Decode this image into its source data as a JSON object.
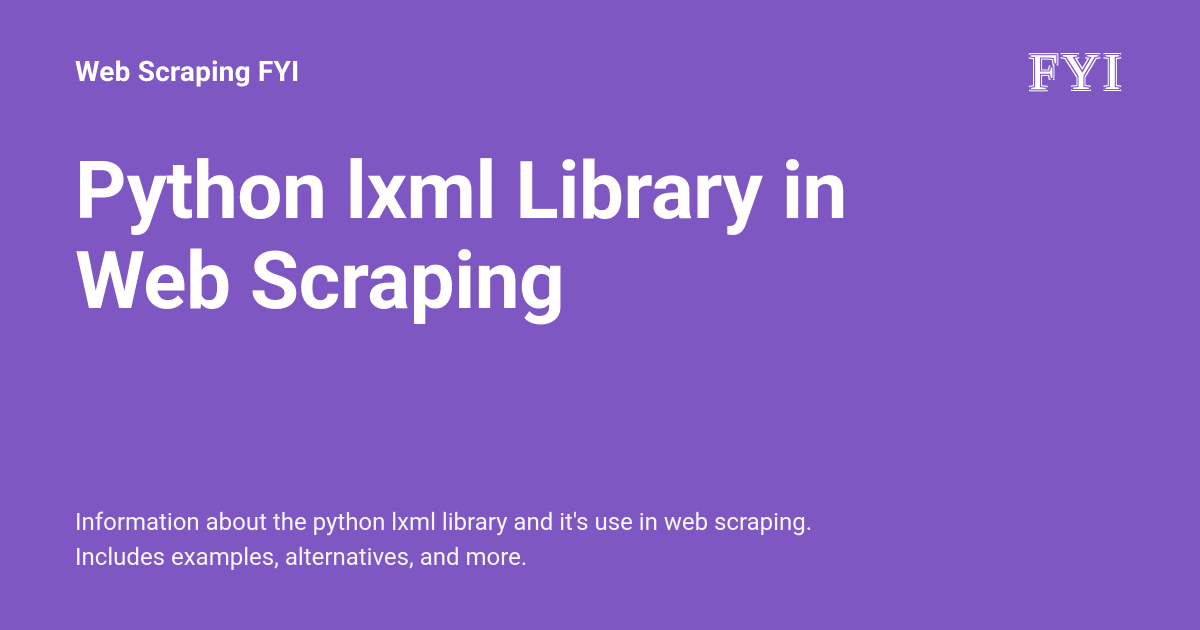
{
  "header": {
    "site_name": "Web Scraping FYI",
    "logo_text": "FYI"
  },
  "main": {
    "title": "Python lxml Library in Web Scraping",
    "description": "Information about the python lxml library and it's use in web scraping. Includes examples, alternatives, and more."
  },
  "colors": {
    "background": "#7E57C2",
    "text": "#ffffff"
  }
}
